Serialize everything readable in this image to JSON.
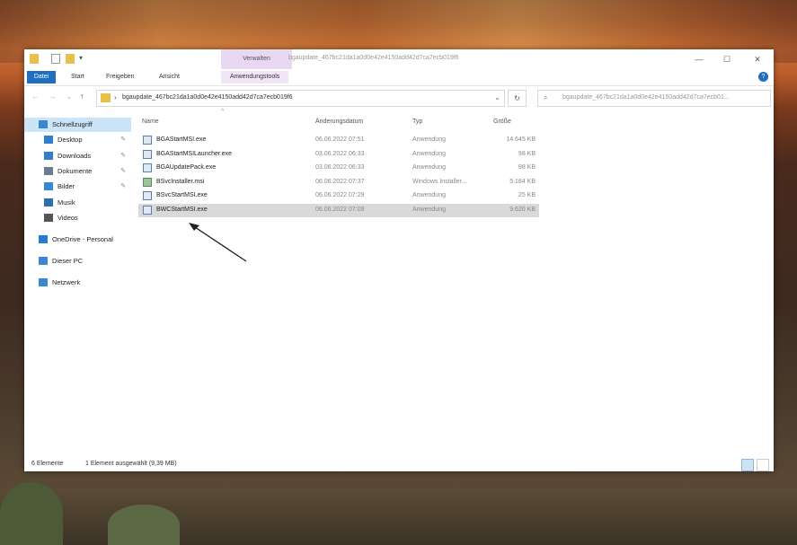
{
  "window": {
    "title": "bgaupdate_467bc21da1a0d0e42e4150add42d7ca7ecb019f6",
    "context_group_label": "Verwalten",
    "controls": {
      "minimize": "—",
      "maximize": "☐",
      "close": "✕"
    }
  },
  "ribbon": {
    "tabs": [
      "Datei",
      "Start",
      "Freigeben",
      "Ansicht",
      "Anwendungstools"
    ],
    "help": "?"
  },
  "address": {
    "path": "bgaupdate_467bc21da1a0d0e42e4150add42d7ca7ecb019f6",
    "search_placeholder": "bgaupdate_467bc21da1a0d0e42e4150add42d7ca7ecb01..."
  },
  "nav": {
    "items": [
      {
        "label": "Schnellzugriff",
        "icon": "star-icon",
        "pinned": false,
        "selected": true
      },
      {
        "label": "Desktop",
        "icon": "desktop-icon",
        "pinned": true
      },
      {
        "label": "Downloads",
        "icon": "download-icon",
        "pinned": true
      },
      {
        "label": "Dokumente",
        "icon": "document-icon",
        "pinned": true
      },
      {
        "label": "Bilder",
        "icon": "pictures-icon",
        "pinned": true
      },
      {
        "label": "Musik",
        "icon": "music-icon",
        "pinned": false
      },
      {
        "label": "Videos",
        "icon": "video-icon",
        "pinned": false
      },
      {
        "label": "OneDrive - Personal",
        "icon": "cloud-icon",
        "pinned": false
      },
      {
        "label": "Dieser PC",
        "icon": "pc-icon",
        "pinned": false
      },
      {
        "label": "Netzwerk",
        "icon": "network-icon",
        "pinned": false
      }
    ],
    "pin_glyph": "✎"
  },
  "list": {
    "columns": {
      "name": "Name",
      "date": "Änderungsdatum",
      "type": "Typ",
      "size": "Größe"
    },
    "rows": [
      {
        "name": "BGAStartMSI.exe",
        "date": "06.06.2022 07:51",
        "type": "Anwendung",
        "size": "14.645 KB",
        "icon": "exe-icon",
        "selected": false
      },
      {
        "name": "BGAStartMSILauncher.exe",
        "date": "03.06.2022 06:33",
        "type": "Anwendung",
        "size": "98 KB",
        "icon": "exe-icon",
        "selected": false
      },
      {
        "name": "BGAUpdatePack.exe",
        "date": "03.06.2022 06:33",
        "type": "Anwendung",
        "size": "98 KB",
        "icon": "exe-icon",
        "selected": false
      },
      {
        "name": "BSvcInstaller.msi",
        "date": "06.06.2022 07:37",
        "type": "Windows Installer...",
        "size": "5.184 KB",
        "icon": "msi-icon",
        "selected": false
      },
      {
        "name": "BSvcStartMSI.exe",
        "date": "06.06.2022 07:29",
        "type": "Anwendung",
        "size": "25 KB",
        "icon": "exe-icon",
        "selected": false
      },
      {
        "name": "BWCStartMSI.exe",
        "date": "06.06.2022 07:09",
        "type": "Anwendung",
        "size": "9.620 KB",
        "icon": "exe-icon",
        "selected": true
      }
    ]
  },
  "status": {
    "count": "6 Elemente",
    "selection": "1 Element ausgewählt (9,39 MB)"
  },
  "colors": {
    "accent": "#1f6fc0",
    "selected_row": "#d9d9d9",
    "nav_selected": "#cce4f7",
    "context_tab": "#e9d8f2"
  }
}
